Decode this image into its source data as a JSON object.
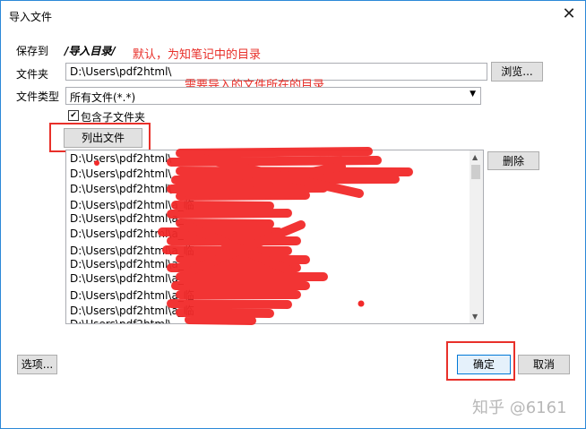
{
  "window": {
    "title": "导入文件",
    "close_glyph": "✕"
  },
  "form": {
    "save_to_label": "保存到",
    "save_to_value": "/导入目录/",
    "folder_label": "文件夹",
    "folder_value": "D:\\Users\\pdf2html\\",
    "browse_label": "浏览...",
    "file_type_label": "文件类型",
    "file_type_value": "所有文件(*.*)",
    "include_subfolders_label": "包含子文件夹",
    "include_subfolders_checked": true,
    "list_files_label": "列出文件"
  },
  "annotations": {
    "default_note": "默认，为知笔记中的目录",
    "folder_note": "需要导入的文件所在的目录"
  },
  "file_list": {
    "rows": [
      "D:\\Users\\pdf2html\\",
      "D:\\Users\\pdf2html\\",
      "D:\\Users\\pdf2html\\",
      "D:\\Users\\pdf2html\\a_临",
      "D:\\Users\\pdf2html\\a_",
      "D:\\Users\\pdf2html\\a_",
      "D:\\Users\\pdf2html\\a_临",
      "D:\\Users\\pdf2html\\a_",
      "D:\\Users\\pdf2html\\a_",
      "D:\\Users\\pdf2html\\a_临",
      "D:\\Users\\pdf2html\\a_临",
      "D:\\Users\\pdf2html\\"
    ],
    "delete_label": "删除"
  },
  "footer": {
    "options_label": "选项...",
    "ok_label": "确定",
    "cancel_label": "取消"
  },
  "watermark": "知乎 @6161",
  "colors": {
    "annotation": "#e8302a",
    "window_border": "#2b88d8"
  }
}
